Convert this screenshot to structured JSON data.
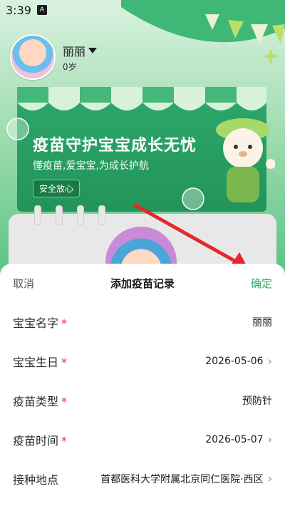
{
  "status_bar": {
    "time": "3:39",
    "badge": "A"
  },
  "profile": {
    "name": "丽丽",
    "age": "0岁"
  },
  "banner": {
    "title": "疫苗守护宝宝成长无忧",
    "subtitle": "懂疫苗,爱宝宝,为成长护航",
    "badge": "安全放心"
  },
  "sheet": {
    "cancel": "取消",
    "title": "添加疫苗记录",
    "confirm": "确定",
    "rows": [
      {
        "label": "宝宝名字",
        "required": "*",
        "value": "丽丽",
        "chevron": ""
      },
      {
        "label": "宝宝生日",
        "required": "*",
        "value": "2026-05-06",
        "chevron": "›"
      },
      {
        "label": "疫苗类型",
        "required": "*",
        "value": "预防针",
        "chevron": ""
      },
      {
        "label": "疫苗时间",
        "required": "*",
        "value": "2026-05-07",
        "chevron": "›"
      },
      {
        "label": "接种地点",
        "required": "",
        "value": "首都医科大学附属北京同仁医院·西区",
        "chevron": "›"
      }
    ]
  },
  "colors": {
    "accent": "#2fa86a",
    "required": "#ee3333",
    "arrow": "#e8262a"
  }
}
